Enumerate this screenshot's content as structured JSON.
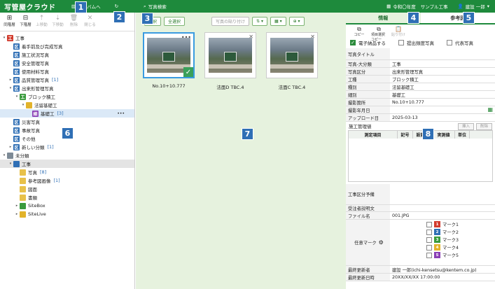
{
  "app": {
    "logo": "写管屋クラウド"
  },
  "topbar": {
    "album_label": "アルバムへ",
    "search_label": "写真検索",
    "year_label": "令和〇年度",
    "project_label": "サンプル工事",
    "user_label": "建設 一郎"
  },
  "badges": [
    "1",
    "2",
    "3",
    "4",
    "5",
    "6",
    "7",
    "8"
  ],
  "left_toolbar": [
    {
      "label": "同階層",
      "icon": "⊞",
      "enabled": true
    },
    {
      "label": "下階層",
      "icon": "⊟",
      "enabled": true
    },
    {
      "label": "上移動",
      "icon": "⇡",
      "enabled": false
    },
    {
      "label": "下移動",
      "icon": "⇣",
      "enabled": false
    },
    {
      "label": "削除",
      "icon": "🗑",
      "enabled": false
    },
    {
      "label": "閉じる",
      "icon": "✕",
      "enabled": false
    }
  ],
  "tree": [
    {
      "label": "工事",
      "icon": "工",
      "color": "red",
      "level": 0,
      "tw": "▾",
      "count": ""
    },
    {
      "label": "着手前及び完成写真",
      "icon": "区",
      "color": "blue",
      "level": 1,
      "tw": "",
      "count": ""
    },
    {
      "label": "施工状況写真",
      "icon": "区",
      "color": "blue",
      "level": 1,
      "tw": "",
      "count": ""
    },
    {
      "label": "安全管理写真",
      "icon": "区",
      "color": "blue",
      "level": 1,
      "tw": "",
      "count": ""
    },
    {
      "label": "使用材料写真",
      "icon": "区",
      "color": "blue",
      "level": 1,
      "tw": "",
      "count": ""
    },
    {
      "label": "品質管理写真",
      "icon": "区",
      "color": "blue",
      "level": 1,
      "tw": "▸",
      "count": "[1]"
    },
    {
      "label": "出来形管理写真",
      "icon": "区",
      "color": "blue",
      "level": 1,
      "tw": "▾",
      "count": ""
    },
    {
      "label": "ブロック積工",
      "icon": "工",
      "color": "green",
      "level": 2,
      "tw": "▾",
      "count": ""
    },
    {
      "label": "法留基礎工",
      "icon": "",
      "color": "yellow",
      "level": 3,
      "tw": "▾",
      "count": ""
    },
    {
      "label": "基礎工",
      "icon": "細",
      "color": "purple",
      "level": 4,
      "tw": "",
      "count": "[3]",
      "selected": true
    },
    {
      "label": "災害写真",
      "icon": "区",
      "color": "blue",
      "level": 1,
      "tw": "",
      "count": ""
    },
    {
      "label": "事故写真",
      "icon": "区",
      "color": "blue",
      "level": 1,
      "tw": "",
      "count": ""
    },
    {
      "label": "その他",
      "icon": "区",
      "color": "blue",
      "level": 1,
      "tw": "",
      "count": ""
    },
    {
      "label": "新しい分類",
      "icon": "区",
      "color": "blue",
      "level": 1,
      "tw": "▸",
      "count": "[1]"
    },
    {
      "label": "未分類",
      "icon": "",
      "color": "gray",
      "level": 0,
      "tw": "▾",
      "count": ""
    },
    {
      "label": "工事",
      "icon": "",
      "color": "blue",
      "level": 1,
      "tw": "▾",
      "count": "",
      "highlight": true
    },
    {
      "label": "写真",
      "icon": "",
      "color": "folder",
      "level": 2,
      "tw": "",
      "count": "[8]"
    },
    {
      "label": "参考図画像",
      "icon": "",
      "color": "folder",
      "level": 2,
      "tw": "",
      "count": "[1]"
    },
    {
      "label": "図面",
      "icon": "",
      "color": "folder",
      "level": 2,
      "tw": "",
      "count": ""
    },
    {
      "label": "書類",
      "icon": "",
      "color": "folder",
      "level": 2,
      "tw": "",
      "count": ""
    },
    {
      "label": "SiteBox",
      "icon": "",
      "color": "green",
      "level": 2,
      "tw": "▸",
      "count": ""
    },
    {
      "label": "SiteLive",
      "icon": "",
      "color": "yellow",
      "level": 2,
      "tw": "▸",
      "count": ""
    }
  ],
  "center": {
    "select_label": "選択",
    "select_all_label": "全選択",
    "paste_label": "写真の貼り付け",
    "photos": [
      {
        "caption": "No.10+10.777",
        "selected": true
      },
      {
        "caption": "法面D TBC.4",
        "selected": false
      },
      {
        "caption": "法面C TBC.4",
        "selected": false
      }
    ]
  },
  "right": {
    "tabs": [
      "情報",
      "参考図"
    ],
    "tools": [
      {
        "label": "コピー",
        "icon": "⧉",
        "enabled": true
      },
      {
        "label": "項目選択コピー",
        "icon": "⧉",
        "enabled": true
      },
      {
        "label": "貼り付け",
        "icon": "📋",
        "enabled": false
      }
    ],
    "checks": [
      {
        "label": "電子納品する",
        "checked": true
      },
      {
        "label": "提出頻度写真",
        "checked": false
      },
      {
        "label": "代表写真",
        "checked": false
      }
    ],
    "fields": [
      {
        "label": "写真タイトル",
        "value": ""
      },
      {
        "label": "写真-大分類",
        "value": "工事"
      },
      {
        "label": "写真区分",
        "value": "出来形管理写真"
      },
      {
        "label": "工種",
        "value": "ブロック積工"
      },
      {
        "label": "種別",
        "value": "法留基礎工"
      },
      {
        "label": "細別",
        "value": "基礎工"
      },
      {
        "label": "撮影箇所",
        "value": "No.10+10.777"
      },
      {
        "label": "撮影年月日",
        "value": ""
      },
      {
        "label": "アップロード日",
        "value": "2025-03-13"
      }
    ],
    "section_label": "施工管理値",
    "insert_label": "挿入",
    "delete_label": "削除",
    "table_headers": [
      "測定項目",
      "記号",
      "設計値",
      "実測値",
      "単位"
    ],
    "fields2": [
      {
        "label": "工事区分予備",
        "value": ""
      },
      {
        "label": "受注者説明文",
        "value": ""
      },
      {
        "label": "ファイル名",
        "value": "001.JPG"
      }
    ],
    "marks_label": "任意マーク",
    "marks": [
      {
        "label": "マーク1",
        "color": "#d23b2d",
        "num": "1"
      },
      {
        "label": "マーク2",
        "color": "#2f6fb5",
        "num": "2"
      },
      {
        "label": "マーク3",
        "color": "#3a9b3d",
        "num": "3"
      },
      {
        "label": "マーク4",
        "color": "#e2b32a",
        "num": "4"
      },
      {
        "label": "マーク5",
        "color": "#8a3fb5",
        "num": "5"
      }
    ],
    "fields3": [
      {
        "label": "最終更新者",
        "value": "建設 一郎(ichi-kensetsu@kentem.co.jp)"
      },
      {
        "label": "最終更新日時",
        "value": "20XX/XX/XX 17:00:00"
      }
    ]
  }
}
